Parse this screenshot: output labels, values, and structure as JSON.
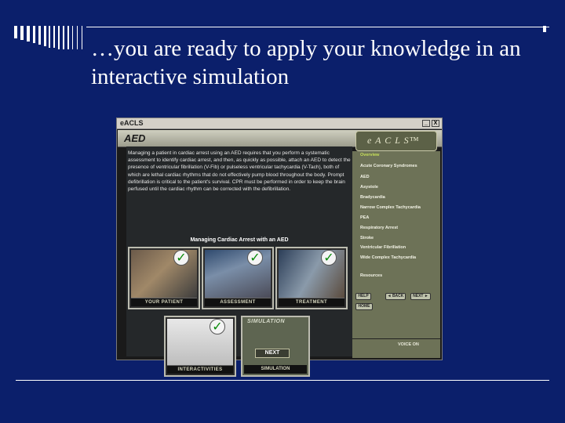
{
  "slide": {
    "title": "…you are ready to apply your knowledge in an interactive simulation"
  },
  "window": {
    "app_name": "eACLS",
    "minimize_label": "_",
    "close_label": "X",
    "page_title": "AED",
    "logo": "e A C L S™",
    "intro_text": "Managing a patient in cardiac arrest using an AED requires that you perform a systematic assessment to identify cardiac arrest, and then, as quickly as possible, attach an AED to detect the presence of ventricular fibrillation (V-Fib) or pulseless ventricular tachycardia (V-Tach), both of which are lethal cardiac rhythms that do not effectively pump blood throughout the body. Prompt defibrillation is critical to the patient's survival. CPR must be performed in order to keep the brain perfused until the cardiac rhythm can be corrected with the defibrillation.",
    "section_heading": "Managing Cardiac Arrest with an AED",
    "thumbnails": [
      {
        "caption": "YOUR PATIENT"
      },
      {
        "caption": "ASSESSMENT"
      },
      {
        "caption": "TREATMENT"
      },
      {
        "caption": "INTERACTIVITIES"
      }
    ],
    "simulation": {
      "label": "SIMULATION",
      "next": "NEXT",
      "caption": "SIMULATION"
    },
    "menu": {
      "items": [
        "Overview",
        "Acute Coronary Syndromes",
        "AED",
        "Asystole",
        "Bradycardia",
        "Narrow Complex Tachycardia",
        "PEA",
        "Respiratory Arrest",
        "Stroke",
        "Ventricular Fibrillation",
        "Wide Complex Tachycardia",
        "Resources"
      ],
      "help": "HELP",
      "back": "◄ BACK",
      "next": "NEXT ►",
      "home": "HOME",
      "voice": "VOICE ON"
    },
    "colors": {
      "slide_bg": "#0b1f6b",
      "menu_bg": "#6d7257",
      "checkmark": "#0a8a0a"
    }
  }
}
